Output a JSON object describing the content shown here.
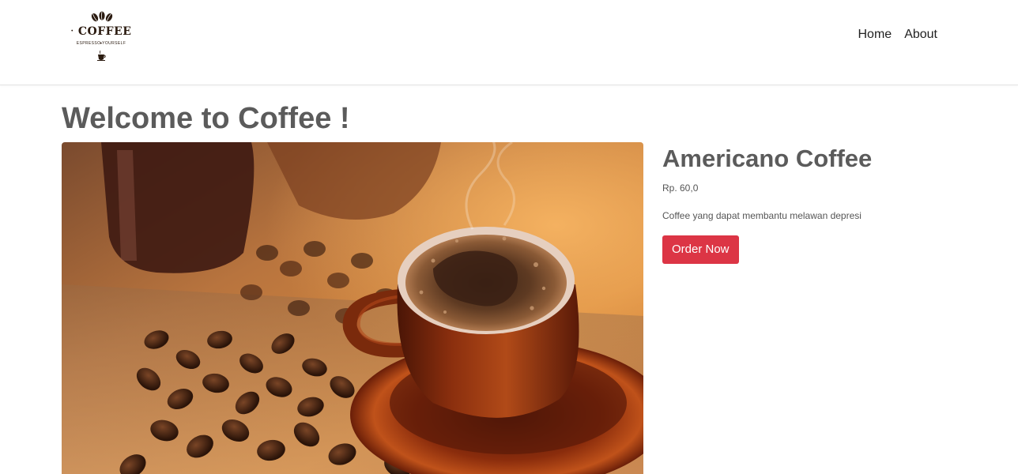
{
  "brand": {
    "name": "COFFEE",
    "tagline": "ESPRESSO YOURSELF"
  },
  "nav": {
    "links": [
      {
        "label": "Home"
      },
      {
        "label": "About"
      }
    ]
  },
  "page": {
    "title": "Welcome to Coffee !"
  },
  "product": {
    "name": "Americano Coffee",
    "price": "Rp. 60,0",
    "description": "Coffee yang dapat membantu melawan depresi",
    "order_label": "Order Now"
  },
  "colors": {
    "accent": "#dc3545",
    "heading": "#5b5b5b",
    "logo": "#2b1b10"
  },
  "icons": {
    "logo_beans": "coffee-beans-icon",
    "logo_cup": "coffee-cup-icon"
  }
}
